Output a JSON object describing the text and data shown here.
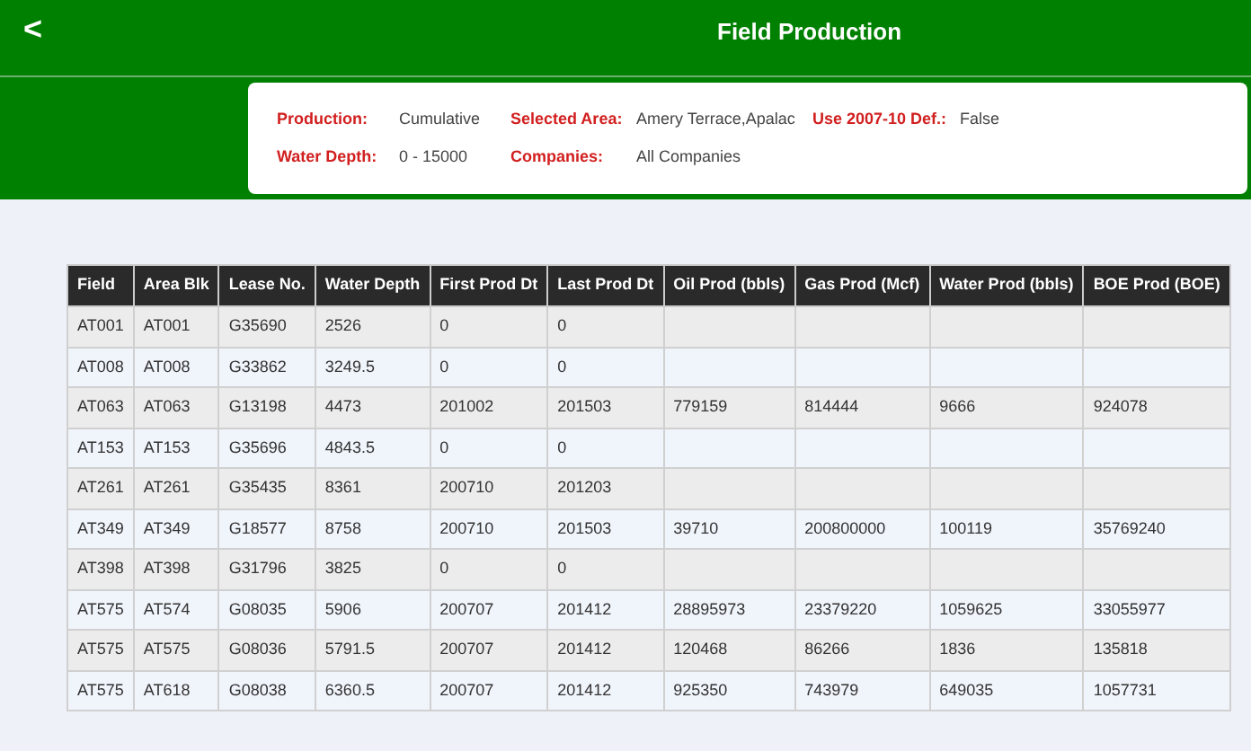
{
  "header": {
    "back_glyph": "<",
    "title": "Field Production"
  },
  "filters": [
    {
      "label": "Production:",
      "value": "Cumulative"
    },
    {
      "label": "Selected Area:",
      "value": "Amery Terrace,Apalac"
    },
    {
      "label": "Use 2007-10 Def.:",
      "value": "False"
    },
    {
      "label": "Water Depth:",
      "value": "0 - 15000"
    },
    {
      "label": "Companies:",
      "value": "All Companies"
    }
  ],
  "table": {
    "columns": [
      "Field",
      "Area Blk",
      "Lease No.",
      "Water Depth",
      "First Prod Dt",
      "Last Prod Dt",
      "Oil Prod (bbls)",
      "Gas Prod (Mcf)",
      "Water Prod (bbls)",
      "BOE Prod (BOE)"
    ],
    "rows": [
      [
        "AT001",
        "AT001",
        "G35690",
        "2526",
        "0",
        "0",
        null,
        null,
        null,
        null
      ],
      [
        "AT008",
        "AT008",
        "G33862",
        "3249.5",
        "0",
        "0",
        null,
        null,
        null,
        null
      ],
      [
        "AT063",
        "AT063",
        "G13198",
        "4473",
        "201002",
        "201503",
        "779159",
        "814444",
        "9666",
        "924078"
      ],
      [
        "AT153",
        "AT153",
        "G35696",
        "4843.5",
        "0",
        "0",
        null,
        null,
        null,
        null
      ],
      [
        "AT261",
        "AT261",
        "G35435",
        "8361",
        "200710",
        "201203",
        null,
        null,
        null,
        null
      ],
      [
        "AT349",
        "AT349",
        "G18577",
        "8758",
        "200710",
        "201503",
        "39710",
        "200800000",
        "100119",
        "35769240"
      ],
      [
        "AT398",
        "AT398",
        "G31796",
        "3825",
        "0",
        "0",
        null,
        null,
        null,
        null
      ],
      [
        "AT575",
        "AT574",
        "G08035",
        "5906",
        "200707",
        "201412",
        "28895973",
        "23379220",
        "1059625",
        "33055977"
      ],
      [
        "AT575",
        "AT575",
        "G08036",
        "5791.5",
        "200707",
        "201412",
        "120468",
        "86266",
        "1836",
        "135818"
      ],
      [
        "AT575",
        "AT618",
        "G08038",
        "6360.5",
        "200707",
        "201412",
        "925350",
        "743979",
        "649035",
        "1057731"
      ]
    ]
  }
}
